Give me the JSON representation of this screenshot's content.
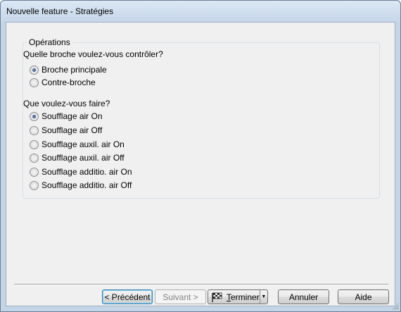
{
  "window": {
    "title": "Nouvelle feature - Stratégies"
  },
  "operations": {
    "legend": "Opérations",
    "spindle_question": "Quelle broche voulez-vous contrôler?",
    "spindle_options": [
      {
        "label": "Broche principale",
        "checked": true
      },
      {
        "label": "Contre-broche",
        "checked": false
      }
    ],
    "action_question": "Que voulez-vous faire?",
    "action_options": [
      {
        "label": "Soufflage air On",
        "checked": true
      },
      {
        "label": "Soufflage air Off",
        "checked": false
      },
      {
        "label": "Soufflage auxil. air On",
        "checked": false
      },
      {
        "label": "Soufflage auxil. air Off",
        "checked": false
      },
      {
        "label": "Soufflage additio. air On",
        "checked": false
      },
      {
        "label": "Soufflage additio. air Off",
        "checked": false
      }
    ]
  },
  "buttons": {
    "previous": "< Précédent",
    "next": "Suivant >",
    "finish_prefix": "T",
    "finish_rest": "erminer",
    "cancel": "Annuler",
    "help": "Aide"
  },
  "icons": {
    "finish": "checkered-flag-icon",
    "dropdown": "chevron-down-icon"
  }
}
